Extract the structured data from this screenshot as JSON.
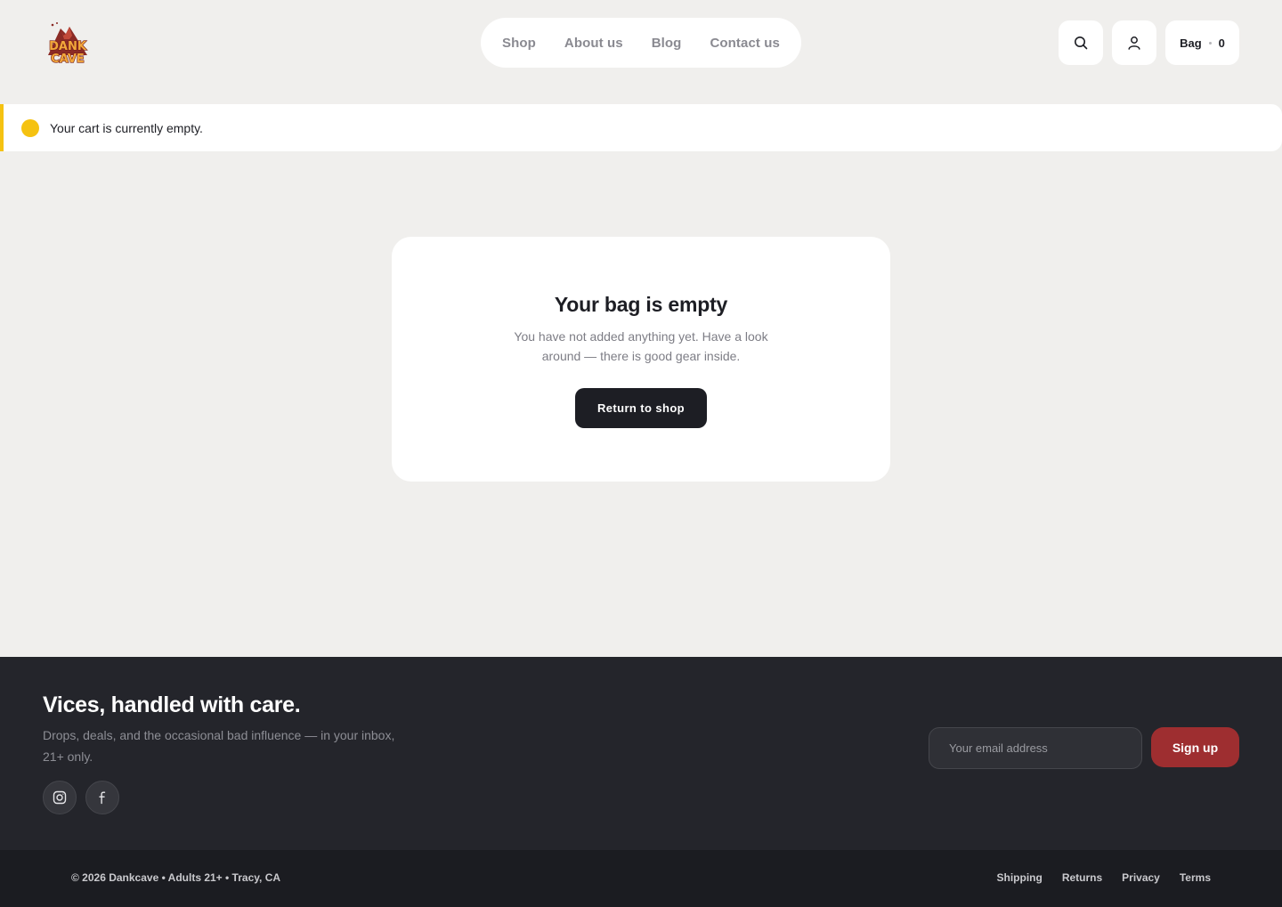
{
  "header": {
    "logo_text": [
      "DANK",
      "CAVE"
    ],
    "nav": [
      "Shop",
      "About us",
      "Blog",
      "Contact us"
    ],
    "bag_label": "Bag",
    "bag_count": "0"
  },
  "notice": {
    "text": "Your cart is currently empty.",
    "accent": "#f5c211"
  },
  "empty_cart": {
    "title": "Your bag is empty",
    "description": "You have not added anything yet. Have a look around — there is good gear inside.",
    "button": "Return to shop"
  },
  "footer": {
    "heading": "Vices, handled with care.",
    "subtext": "Drops, deals, and the occasional bad influence — in your inbox, 21+ only.",
    "social": [
      "instagram-icon",
      "facebook-icon"
    ],
    "email_placeholder": "Your email address",
    "signup": "Sign up",
    "signup_color": "#9e2e30",
    "copyright": "© 2026 Dankcave • Adults 21+ • Tracy, CA",
    "legal": [
      "Shipping",
      "Returns",
      "Privacy",
      "Terms"
    ]
  }
}
